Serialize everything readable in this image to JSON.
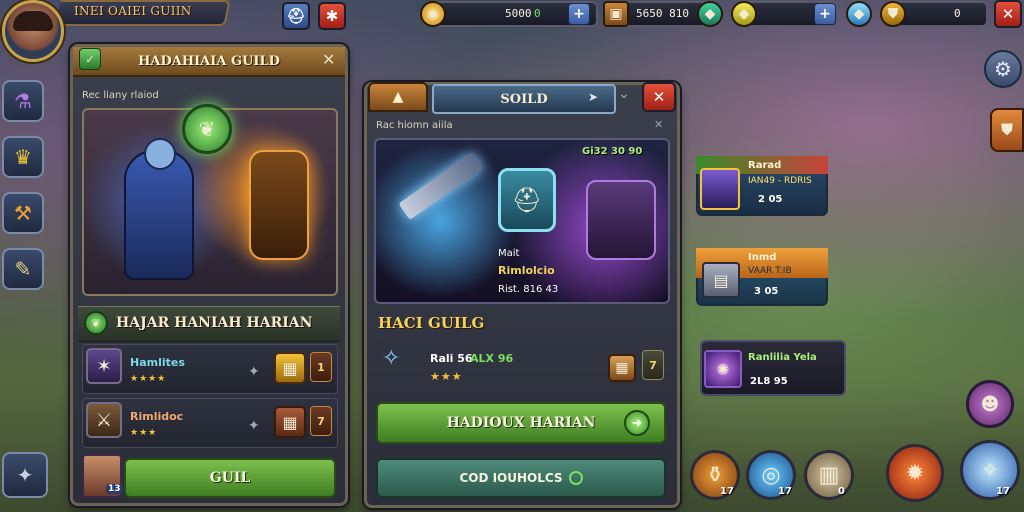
{
  "hud": {
    "player_name": "INEI OAIEI GUIIN",
    "gold": "5000",
    "gold_delta": "0",
    "chest_value": "5650 810",
    "gem_value": "0",
    "plus": "+",
    "close": "✕",
    "share": "✱"
  },
  "left_panel": {
    "title": "HADAHIAIA GUILD",
    "close": "✕",
    "subtitle": "Rec liany rlaiod",
    "section_title": "HAJAR HANIAH HARIAN",
    "items": [
      {
        "name": "Hamlites",
        "stars": "★★★★",
        "count": "1"
      },
      {
        "name": "Rimlidoc",
        "stars": "★★★",
        "count": "7"
      }
    ],
    "button": "GUIL",
    "corner_badge": "13"
  },
  "center_panel": {
    "title": "SOILD",
    "close": "✕",
    "subtitle": "Rac hiomn aiila",
    "art_badge": "Gi32 30 90",
    "art_line1": "Mait",
    "art_line2": "Rimlolcio",
    "art_line3": "Rist. 816 43",
    "section_title": "HACI GUILG",
    "reward_label": "Rali 56",
    "reward_value": "ALX 96",
    "reward_stars": "★★★",
    "reward_count": "7",
    "button_primary": "HADIOUX HARIAN",
    "button_secondary": "COD IOUHOLCS"
  },
  "side_cards": [
    {
      "title": "Rarad",
      "sub": "IAN49 - RDRIS",
      "value": "2 05"
    },
    {
      "title": "Inmd",
      "sub": "VAAR T:IB",
      "value": "3 05"
    },
    {
      "title": "Ranlilia Yela",
      "sub": "",
      "value": "2L8 95"
    }
  ],
  "bottom_buttons": [
    {
      "icon": "potion-icon",
      "count": "17"
    },
    {
      "icon": "portal-icon",
      "count": "17"
    },
    {
      "icon": "barrel-icon",
      "count": "0"
    },
    {
      "icon": "fire-icon",
      "count": ""
    },
    {
      "icon": "crystal-icon",
      "count": "17"
    }
  ],
  "colors": {
    "accent_gold": "#c6a34b",
    "button_green": "#5fa238",
    "button_red": "#c5352a",
    "panel_bg": "#2f323d"
  }
}
